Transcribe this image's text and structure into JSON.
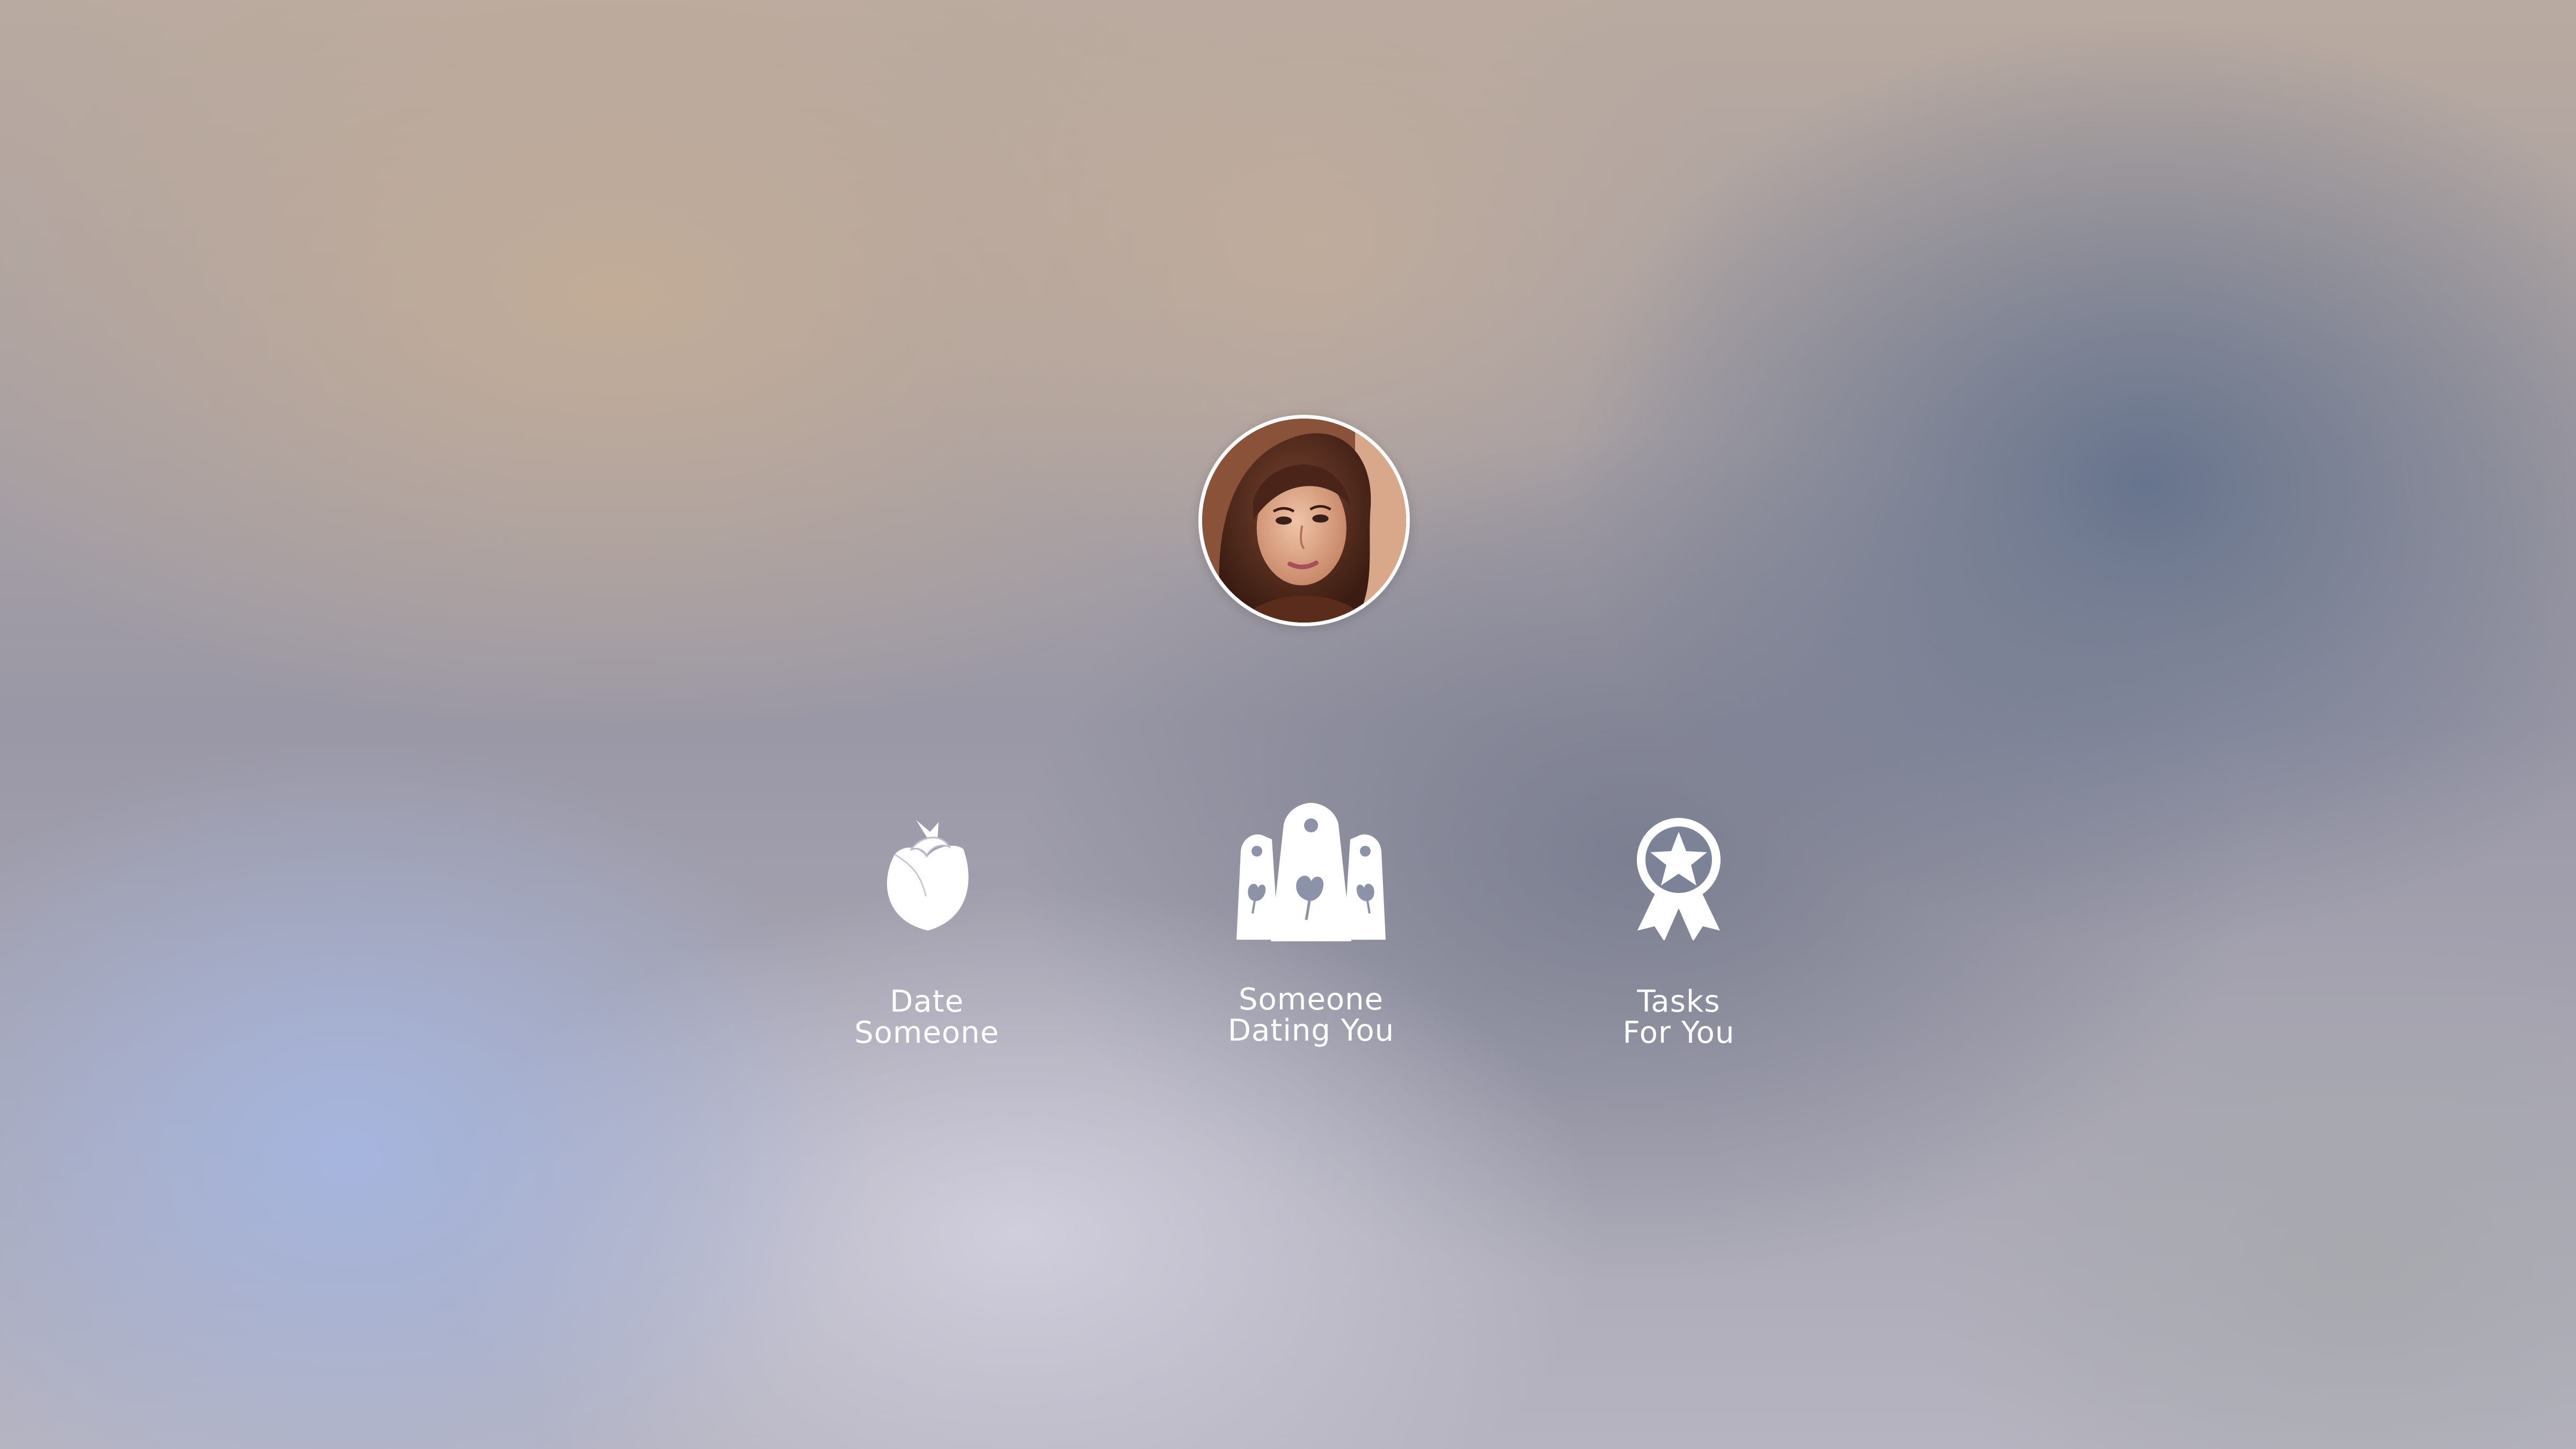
{
  "profile": {
    "avatar_alt": "User profile photo"
  },
  "menu": {
    "items": [
      {
        "id": "date-someone",
        "line1": "Date",
        "line2": "Someone",
        "icon": "rose-icon"
      },
      {
        "id": "someone-dating-you",
        "line1": "Someone",
        "line2": "Dating You",
        "icon": "rose-tags-icon"
      },
      {
        "id": "tasks-for-you",
        "line1": "Tasks",
        "line2": "For You",
        "icon": "award-ribbon-icon"
      }
    ]
  },
  "colors": {
    "icon": "#ffffff",
    "label": "#ffffff",
    "avatar_border": "#ffffff"
  }
}
